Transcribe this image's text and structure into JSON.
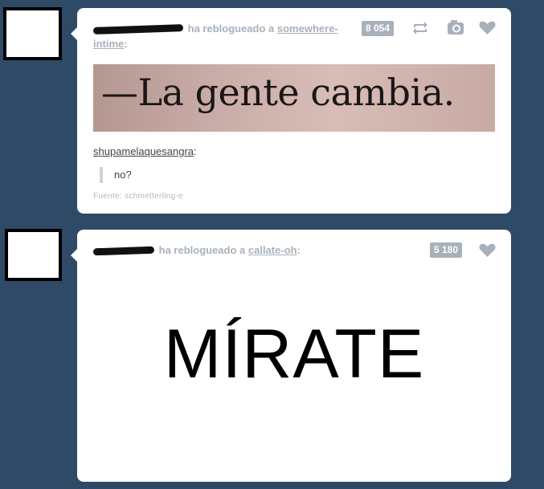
{
  "posts": [
    {
      "action": "ha reblogueado a",
      "source_blog_line1": "somewhere-",
      "source_blog_line2": "intime",
      "suffix": ":",
      "note_count": "8 054",
      "quote_image_text": "—La gente cambia.",
      "reblogger": "shupamelaquesangra",
      "reblogger_suffix": ":",
      "comment": "no?",
      "source_label": "Fuente: schmetterling-e",
      "icons": [
        "reblog-icon",
        "camera-icon",
        "heart-icon"
      ]
    },
    {
      "action": "ha reblogueado a",
      "source_blog": "callate-oh",
      "suffix": ":",
      "note_count": "5 180",
      "image_text": "MÍRATE",
      "icons": [
        "heart-icon"
      ]
    }
  ],
  "colors": {
    "background": "#2f4a67",
    "card": "#ffffff",
    "muted": "#a8b1ba"
  }
}
